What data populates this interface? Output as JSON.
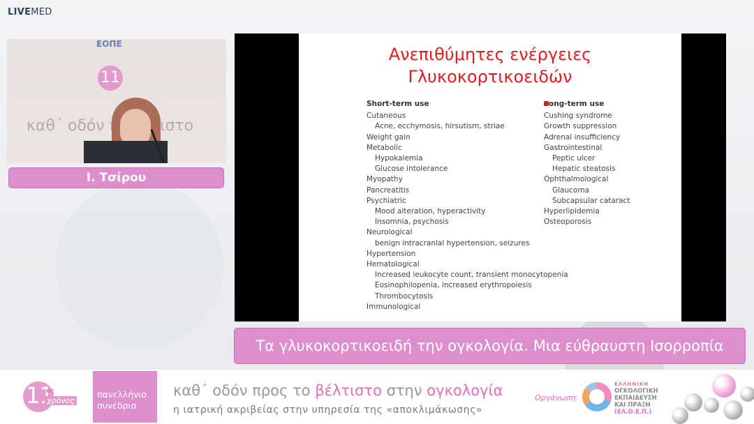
{
  "brand": {
    "part1": "LIVE",
    "part2": "MED"
  },
  "speaker": {
    "name": "Ι. Τσίρου"
  },
  "video": {
    "wall_logo": "ΕΟΠΕ",
    "wall_number": "11",
    "wall_text": "καθ΄ οδόν π    βέλτιστο"
  },
  "slide": {
    "title_line1": "Ανεπιθύμητες ενέργειες",
    "title_line2": "Γλυκοκορτικοειδών",
    "short_term": {
      "header": "Short-term use",
      "items": [
        {
          "text": "Cutaneous",
          "sub": false
        },
        {
          "text": "Acne, ecchymosis, hirsutism, striae",
          "sub": true
        },
        {
          "text": "Weight gain",
          "sub": false
        },
        {
          "text": "Metabolic",
          "sub": false
        },
        {
          "text": "Hypokalemia",
          "sub": true
        },
        {
          "text": "Glucose intolerance",
          "sub": true
        },
        {
          "text": "Myopathy",
          "sub": false
        },
        {
          "text": "Pancreatitis",
          "sub": false
        },
        {
          "text": "Psychiatric",
          "sub": false
        },
        {
          "text": "Mood alteration, hyperactivity",
          "sub": true
        },
        {
          "text": "Insomnia, psychosis",
          "sub": true
        },
        {
          "text": "Neurological",
          "sub": false
        },
        {
          "text": "benign intracranial hypertension, seizures",
          "sub": true
        },
        {
          "text": "Hypertension",
          "sub": false
        },
        {
          "text": "Hematological",
          "sub": false
        },
        {
          "text": "Increased leukocyte count, transient monocytopenia",
          "sub": true
        },
        {
          "text": "Eosinophilopenia, increased erythropoiesis",
          "sub": true
        },
        {
          "text": "Thrombocytosis",
          "sub": true
        },
        {
          "text": "Immunological",
          "sub": false
        }
      ]
    },
    "long_term": {
      "header": "ong-term use",
      "items": [
        {
          "text": "Cushing syndrome",
          "sub": false
        },
        {
          "text": "Growth suppression",
          "sub": false
        },
        {
          "text": "Adrenal insufficiency",
          "sub": false
        },
        {
          "text": "Gastrointestinal",
          "sub": false
        },
        {
          "text": "Peptic ulcer",
          "sub": true
        },
        {
          "text": "Hepatic steatosis",
          "sub": true
        },
        {
          "text": "Ophthalmological",
          "sub": false
        },
        {
          "text": "Glaucoma",
          "sub": true
        },
        {
          "text": "Subcapsular cataract",
          "sub": true
        },
        {
          "text": "Hyperlipidemia",
          "sub": false
        },
        {
          "text": "Osteoporosis",
          "sub": false
        }
      ]
    }
  },
  "talk_title": "Τα γλυκοκορτικοειδή την ογκολογία. Μια εύθραυστη Ισορροπία",
  "banner": {
    "number": "11",
    "os": "ος",
    "xronos": "χρόνος",
    "pan_line1": "πανελλήνιο",
    "pan_line2": "συνέδριο",
    "motto_a": "καθ΄ οδόν προς το ",
    "motto_b": "βέλτιστο",
    "motto_c": " στην ",
    "motto_d": "ογκολογία",
    "sub_motto": "η ιατρική ακριβείας στην υπηρεσία της «αποκλιμάκωσης»",
    "org_label": "Οργάνωση:",
    "org_lines": [
      "ΕΛΛΗΝΙΚΗ",
      "ΟΓΚΟΛΟΓΙΚΗ",
      "ΕΚΠΑΙΔΕΥΣΗ",
      "ΚΑΙ ΠΡΑΞΗ",
      "(ΕΛ.Ο.Ε.Π.)"
    ]
  },
  "colors": {
    "pink": "#dd8fcd",
    "accent_pink": "#e36fba",
    "slide_title_red": "#e31b23"
  }
}
